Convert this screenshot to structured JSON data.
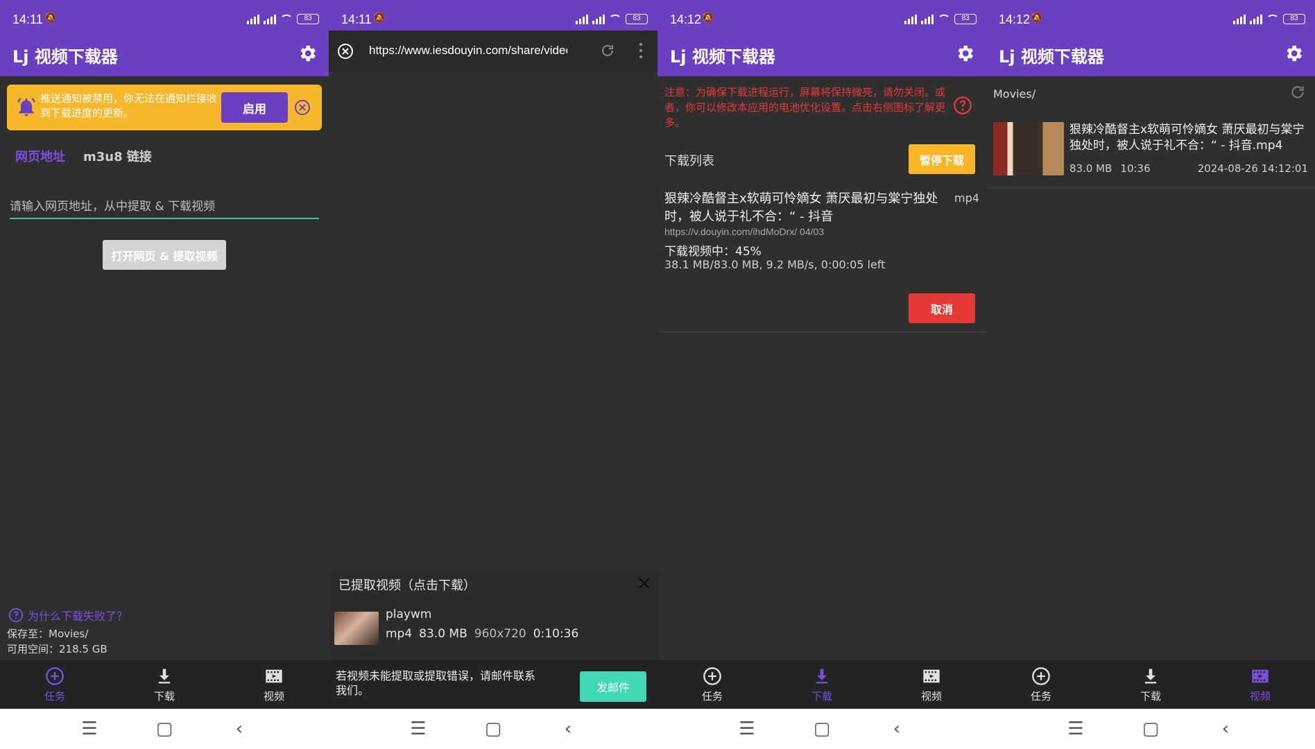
{
  "app": {
    "title": "Lj 视频下载器",
    "accent": "#6a3fc1"
  },
  "status": {
    "times": [
      "14:11",
      "14:11",
      "14:12",
      "14:12"
    ],
    "battery": "83"
  },
  "nav": {
    "tasks": "任务",
    "download": "下载",
    "videos": "视频"
  },
  "screen1": {
    "banner_text": "推送通知被禁用，你无法在通知栏接收到下载进度的更新。",
    "enable_label": "启用",
    "tab_web": "网页地址",
    "tab_m3u8": "m3u8 链接",
    "url_placeholder": "请输入网页地址，从中提取 & 下载视频",
    "open_button": "打开网页 & 提取视频",
    "why_failed": "为什么下载失败了？",
    "save_path": "保存至：Movies/",
    "free_space": "可用空间：218.5 GB"
  },
  "screen2": {
    "url": "https://www.iesdouyin.com/share/video/",
    "extracted_header": "已提取视频（点击下载）",
    "video_name": "playwm",
    "video_format": "mp4",
    "video_size": "83.0 MB",
    "video_resolution": "960x720",
    "video_duration": "0:10:36",
    "mail_text": "若视频未能提取或提取错误，请邮件联系我们。",
    "mail_button": "发邮件"
  },
  "screen3": {
    "warning": "注意：为确保下载进程运行，屏幕将保持微亮，请勿关闭。或者，你可以修改本应用的电池优化设置。点击右侧图标了解更多。",
    "list_header": "下载列表",
    "pause_button": "暂停下载",
    "item_title": "狠辣冷酷督主x软萌可怜嫡女 萧厌最初与棠宁独处时，被人说于礼不合：“ - 抖音",
    "item_ext": "mp4",
    "item_url": "https://v.douyin.com/ihdMoDrx/ 04/03",
    "item_status": "下载视频中：45%",
    "item_progress": "38.1 MB/83.0 MB, 9.2 MB/s, 0:00:05 left",
    "cancel_button": "取消"
  },
  "screen4": {
    "path": "Movies/",
    "file_title": "狠辣冷酷督主x软萌可怜嫡女 萧厌最初与棠宁独处时，被人说于礼不合：“ - 抖音.mp4",
    "file_size": "83.0 MB",
    "file_duration": "10:36",
    "file_date": "2024-08-26 14:12:01"
  }
}
